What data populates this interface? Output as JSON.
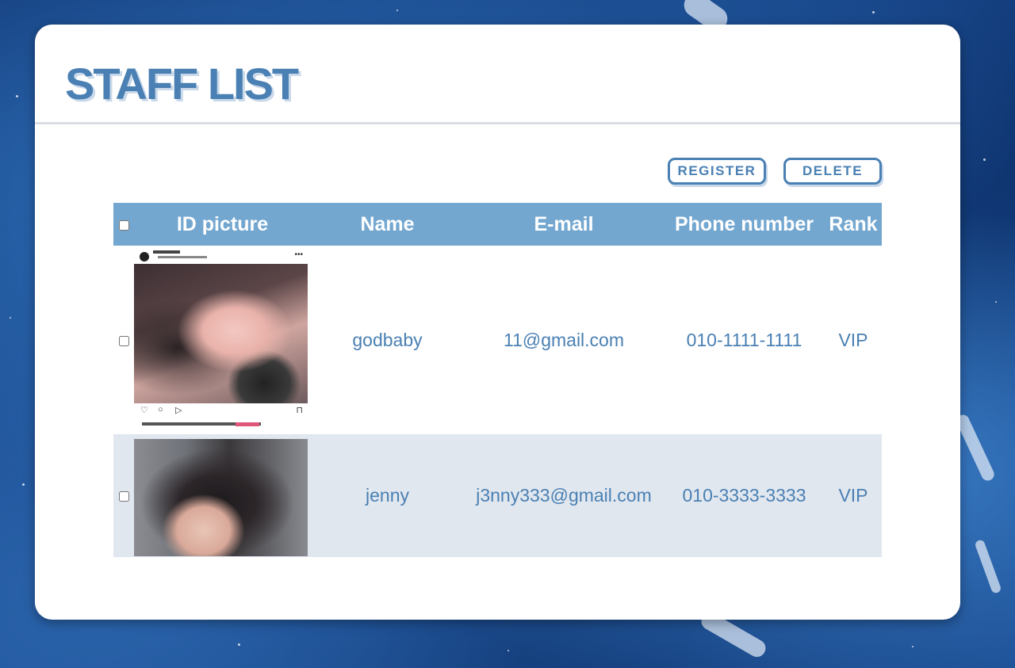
{
  "page": {
    "title": "STAFF LIST"
  },
  "actions": {
    "register_label": "REGISTER",
    "delete_label": "DELETE"
  },
  "table": {
    "headers": [
      "ID picture",
      "Name",
      "E-mail",
      "Phone number",
      "Rank"
    ],
    "rows": [
      {
        "name": "godbaby",
        "email": "11@gmail.com",
        "phone": "010-1111-1111",
        "rank": "VIP",
        "picture": "instagram-post-photo"
      },
      {
        "name": "jenny",
        "email": "j3nny333@gmail.com",
        "phone": "010-3333-3333",
        "rank": "VIP",
        "picture": "portrait-photo"
      }
    ]
  },
  "colors": {
    "accent": "#4a80b3",
    "header_bg": "#74a7d0",
    "alt_row_bg": "#e1e7ef"
  }
}
